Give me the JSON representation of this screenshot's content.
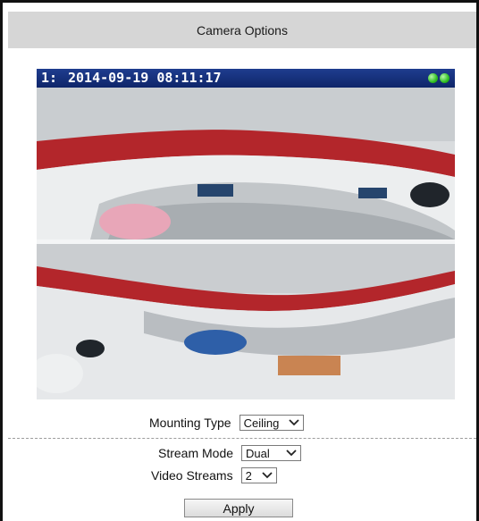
{
  "header": {
    "title": "Camera Options"
  },
  "video": {
    "channel": "1:",
    "timestamp": "2014-09-19 08:11:17",
    "status_leds": [
      "green",
      "green"
    ]
  },
  "mounting": {
    "label": "Mounting Type",
    "value": "Ceiling"
  },
  "stream_mode": {
    "label": "Stream Mode",
    "value": "Dual"
  },
  "video_streams": {
    "label": "Video Streams",
    "value": "2"
  },
  "apply": {
    "label": "Apply"
  },
  "colors": {
    "header_bg": "#d6d6d6",
    "osd_bg": "#0e2569",
    "led": "#2fbf22"
  }
}
